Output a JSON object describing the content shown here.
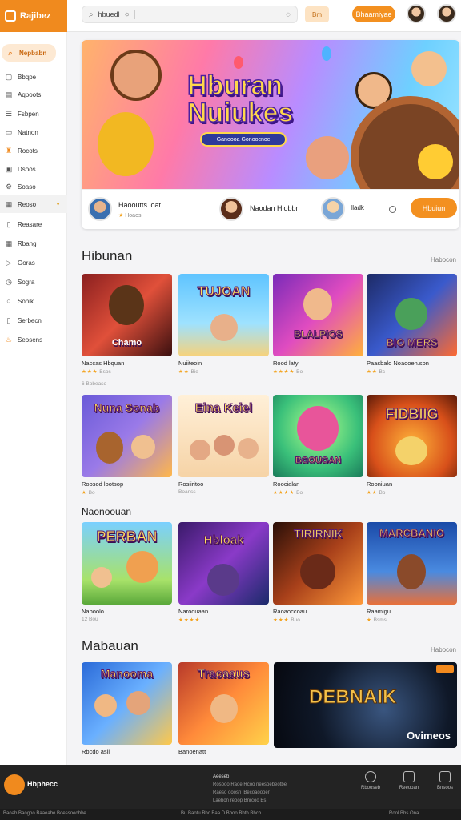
{
  "header": {
    "brand": "Rajibez",
    "search_value": "hbuedl",
    "mini_button": "Bm",
    "primary_button": "Bhaamiyae"
  },
  "sidebar": {
    "items": [
      {
        "label": "Nepbabn",
        "icon": "search-icon"
      },
      {
        "label": "Bbqpe",
        "icon": "home-icon"
      },
      {
        "label": "Aqboots",
        "icon": "grid-icon"
      },
      {
        "label": "Fsbpen",
        "icon": "list-icon"
      },
      {
        "label": "Natnon",
        "icon": "square-icon"
      },
      {
        "label": "Rocots",
        "icon": "trophy-icon"
      },
      {
        "label": "Dsoos",
        "icon": "image-icon"
      },
      {
        "label": "Soaso",
        "icon": "gear-icon"
      },
      {
        "label": "Reoso",
        "icon": "layout-icon"
      },
      {
        "label": "Reasare",
        "icon": "doc-icon"
      },
      {
        "label": "Rbang",
        "icon": "table-icon"
      },
      {
        "label": "Ooras",
        "icon": "play-icon"
      },
      {
        "label": "Sogra",
        "icon": "clock-icon"
      },
      {
        "label": "Sonik",
        "icon": "circle-icon"
      },
      {
        "label": "Serbecn",
        "icon": "doc-icon"
      },
      {
        "label": "Seosens",
        "icon": "flame-icon"
      }
    ]
  },
  "hero": {
    "title_line1": "Hburan",
    "title_line2": "Nuiukes",
    "subtitle": "Ganoooa Gonoocnoc",
    "creators": [
      {
        "name": "Haooutts loat",
        "sub": "Hoaos"
      },
      {
        "name": "Naodan Hlobbn",
        "sub": ""
      },
      {
        "name": "Iladk",
        "sub": ""
      }
    ],
    "cta": "Hbuiun"
  },
  "sections": [
    {
      "title": "Hibunan",
      "more": "Habocon"
    },
    {
      "title": "Naonoouan",
      "more": ""
    },
    {
      "title": "Mabauan",
      "more": "Habocon"
    }
  ],
  "cards_row1": [
    {
      "art": "Chamo",
      "name": "Naccas Hbquan",
      "stars": "★★★",
      "meta": "Bsos"
    },
    {
      "art": "TUJOAN",
      "name": "Nuiiteoin",
      "stars": "★★",
      "meta": "Bie"
    },
    {
      "art": "BLALPIOS",
      "name": "Rood laty",
      "stars": "★★★★",
      "meta": "Bo"
    },
    {
      "art": "BIO MERS",
      "name": "Paasbalo Noaooen.son",
      "stars": "★★",
      "meta": "Bc"
    }
  ],
  "cards_row1_note": "6 Bobeaso",
  "cards_row2": [
    {
      "art": "Nuna Sonab",
      "name": "Roosod lootsop",
      "stars": "★",
      "meta": "Bo"
    },
    {
      "art": "Eina Keiel",
      "name": "Rosiiritoo",
      "stars": "",
      "meta": "Boanss"
    },
    {
      "art": "BGOUOAN",
      "name": "Roocialan",
      "stars": "★★★★",
      "meta": "Bo"
    },
    {
      "art": "FIDBIIG",
      "name": "Rooniuan",
      "stars": "★★",
      "meta": "Bo"
    }
  ],
  "cards_row3": [
    {
      "art": "PERBAN",
      "name": "Naboolo",
      "stars": "",
      "meta": "12 Bou"
    },
    {
      "art": "Hbloak",
      "name": "Naroouaan",
      "stars": "★★★★",
      "meta": ""
    },
    {
      "art": "TIRIRNIK",
      "name": "Raoaoccoau",
      "stars": "★★★",
      "meta": "Buo"
    },
    {
      "art": "MARCBANIO",
      "name": "Raamigu",
      "stars": "★",
      "meta": "Bsms"
    }
  ],
  "cards_row4": [
    {
      "art": "Manooma",
      "name": "Rbcdo asll",
      "stars": "",
      "meta": ""
    },
    {
      "art": "Tracaaus",
      "name": "Banoenatt",
      "stars": "",
      "meta": ""
    }
  ],
  "wide_card": {
    "art": "DEBNAIK",
    "label": "Ovimeos"
  },
  "footer": {
    "brand": "Hbphecc",
    "col_title": "Aeeseb",
    "col_lines": [
      "Rosooo Raoe Rcoo neesoebeotbe",
      "Raeso ooosn lBecoaoooer",
      "Laebon reoop Bnrcoo Bs"
    ],
    "nav": [
      "Rbooseb",
      "Reeooan",
      "Bnsoos"
    ],
    "bottom_left": "Baoab Baogoo Baaoabo Boessoeobbe",
    "bottom_center": "Bu Baotu Bbc Baa D Bboo Bbtb Bbcb",
    "bottom_right": "Rool Bbs  Ona"
  }
}
